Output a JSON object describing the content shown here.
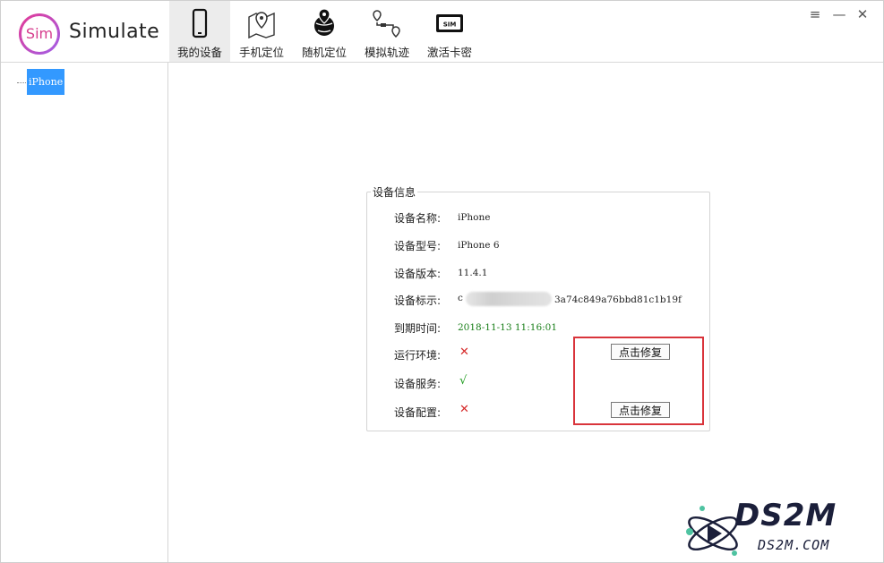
{
  "app": {
    "logo_text": "Sim",
    "title": "Simulate"
  },
  "nav": [
    {
      "label": "我的设备",
      "icon": "phone-icon",
      "active": true
    },
    {
      "label": "手机定位",
      "icon": "map-pin-icon",
      "active": false
    },
    {
      "label": "随机定位",
      "icon": "globe-pin-icon",
      "active": false
    },
    {
      "label": "模拟轨迹",
      "icon": "route-icon",
      "active": false
    },
    {
      "label": "激活卡密",
      "icon": "sim-card-icon",
      "active": false
    }
  ],
  "window_controls": {
    "menu": "≡",
    "minimize": "—",
    "close": "✕"
  },
  "sidebar": {
    "tree": [
      {
        "label": "iPhone",
        "selected": true
      }
    ]
  },
  "device_info": {
    "title": "设备信息",
    "rows": {
      "name": {
        "label": "设备名称:",
        "value": "iPhone"
      },
      "model": {
        "label": "设备型号:",
        "value": "iPhone 6"
      },
      "version": {
        "label": "设备版本:",
        "value": "11.4.1"
      },
      "identifier": {
        "label": "设备标示:",
        "prefix": "c",
        "value": "3a74c849a76bbd81c1b19f"
      },
      "expiry": {
        "label": "到期时间:",
        "value": "2018-11-13 11:16:01"
      },
      "runtime": {
        "label": "运行环境:",
        "status": "✕",
        "button": "点击修复"
      },
      "service": {
        "label": "设备服务:",
        "status": "√"
      },
      "config": {
        "label": "设备配置:",
        "status": "✕",
        "button": "点击修复"
      }
    }
  },
  "watermark": {
    "big": "DS2M",
    "small": "DS2M.COM"
  },
  "colors": {
    "accent": "#3399ff",
    "error": "#d62b2b",
    "ok": "#1a9a1a",
    "highlight": "#d9343b",
    "date": "#1a7f1a"
  }
}
